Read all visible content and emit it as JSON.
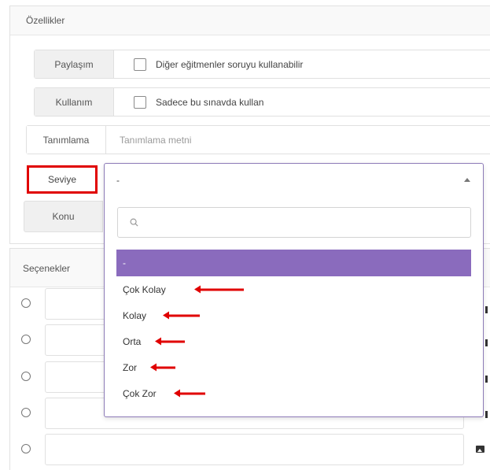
{
  "properties": {
    "title": "Özellikler",
    "share": {
      "label": "Paylaşım",
      "checkbox_text": "Diğer eğitmenler soruyu kullanabilir"
    },
    "usage": {
      "label": "Kullanım",
      "checkbox_text": "Sadece bu sınavda kullan"
    },
    "definition": {
      "label": "Tanımlama",
      "placeholder": "Tanımlama metni"
    },
    "level": {
      "label": "Seviye",
      "selected": "-",
      "options": [
        "-",
        "Çok Kolay",
        "Kolay",
        "Orta",
        "Zor",
        "Çok Zor"
      ]
    },
    "topic": {
      "label": "Konu"
    }
  },
  "options_section": {
    "title": "Seçenekler"
  },
  "colors": {
    "accent": "#8a6bbd",
    "highlight": "#e00000"
  },
  "icons": {
    "search": "search-icon",
    "image": "image-icon",
    "dropdown": "chevron-up-icon"
  }
}
